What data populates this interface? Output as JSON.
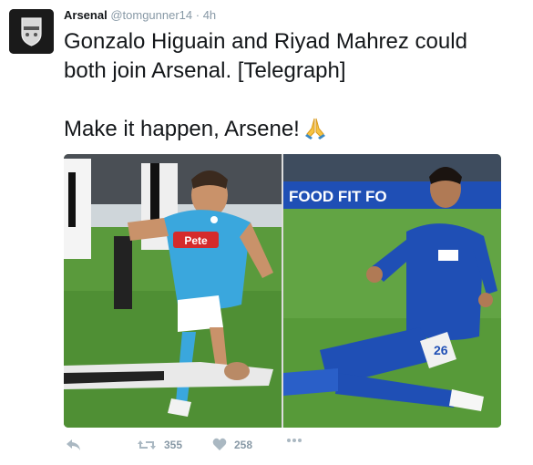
{
  "tweet": {
    "author_name": "Arsenal",
    "handle": "@tomgunner14",
    "time": "· 4h",
    "text_line1": "Gonzalo Higuain and Riyad Mahrez could",
    "text_line2": "both join Arsenal. [Telegraph]",
    "text_line3": "Make it happen, Arsene!",
    "text_emoji": "praying-hands-icon"
  },
  "media": {
    "left_photo_jersey": "Pete",
    "right_photo_banner": "FOOD  FIT  FO",
    "right_photo_jersey_number": "26"
  },
  "actions": {
    "reply_icon": "reply-icon",
    "retweet_icon": "retweet-icon",
    "retweet_count": "355",
    "like_icon": "heart-icon",
    "like_count": "258",
    "more_icon": "more-dots-icon"
  },
  "colors": {
    "napoli_blue": "#3aa7dd",
    "leicester_blue": "#1f4fb5",
    "pitch_green": "#5a9a3c",
    "muted_text": "#8899a6"
  }
}
